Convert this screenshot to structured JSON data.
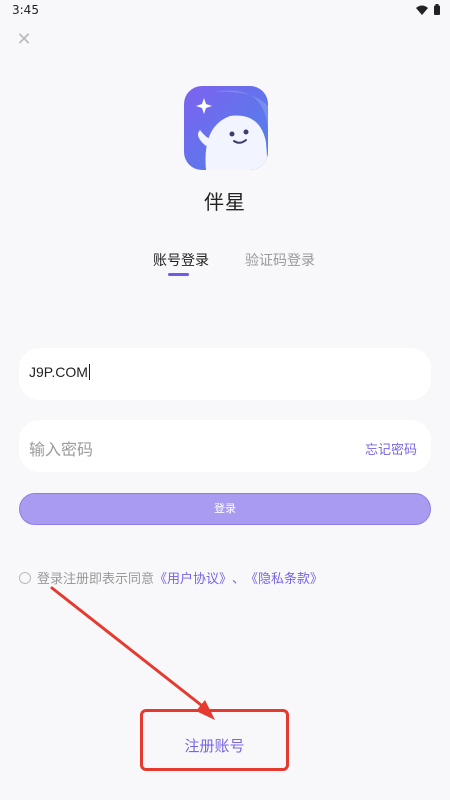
{
  "status_bar": {
    "time": "3:45",
    "icons": [
      "wifi-icon",
      "battery-icon"
    ]
  },
  "header": {
    "close_icon": "close-icon"
  },
  "app": {
    "name": "伴星",
    "logo_icon": "ghost-star-logo"
  },
  "tabs": [
    {
      "label": "账号登录",
      "active": true
    },
    {
      "label": "验证码登录",
      "active": false
    }
  ],
  "form": {
    "account_value": "J9P.COM",
    "password_placeholder": "输入密码",
    "forgot_label": "忘记密码",
    "login_label": "登录"
  },
  "agreement": {
    "prefix": "登录注册即表示同意",
    "user_agreement": "《用户协议》",
    "separator": "、",
    "privacy_policy": "《隐私条款》"
  },
  "footer": {
    "register_label": "注册账号"
  },
  "colors": {
    "accent": "#7a63e6",
    "button": "#a99bf0",
    "annotation": "#e53a2f",
    "background": "#f8f8fa"
  }
}
